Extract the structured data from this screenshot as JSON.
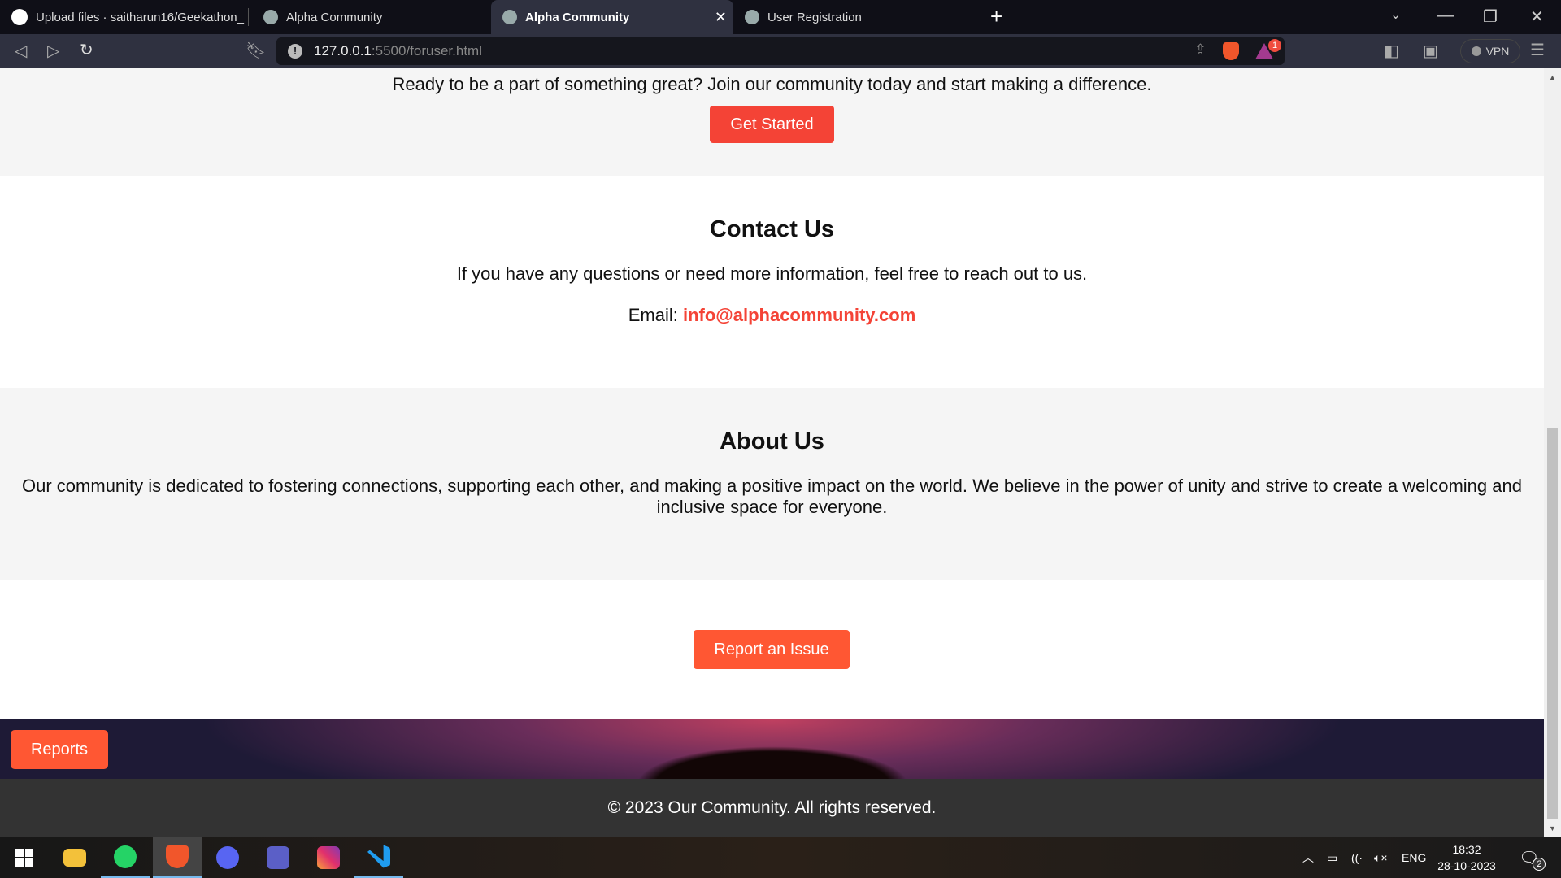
{
  "browser": {
    "tabs": [
      {
        "title": "Upload files · saitharun16/Geekathon_",
        "icon": "github-icon"
      },
      {
        "title": "Alpha Community",
        "icon": "globe-icon"
      },
      {
        "title": "Alpha Community",
        "icon": "globe-icon",
        "active": true
      },
      {
        "title": "User Registration",
        "icon": "globe-icon"
      }
    ],
    "url_host": "127.0.0.1",
    "url_rest": ":5500/foruser.html",
    "vpn_label": "VPN",
    "rewards_badge": "1"
  },
  "page": {
    "cta_text": "Ready to be a part of something great? Join our community today and start making a difference.",
    "get_started": "Get Started",
    "contact": {
      "title": "Contact Us",
      "text": "If you have any questions or need more information, feel free to reach out to us.",
      "email_label": "Email:",
      "email": "info@alphacommunity.com"
    },
    "about": {
      "title": "About Us",
      "text": "Our community is dedicated to fostering connections, supporting each other, and making a positive impact on the world. We believe in the power of unity and strive to create a welcoming and inclusive space for everyone."
    },
    "report_issue": "Report an Issue",
    "reports": "Reports",
    "footer": "© 2023 Our Community. All rights reserved.",
    "colors": {
      "get_started": "#f44336",
      "report": "#ff5733",
      "footer": "#333333"
    }
  },
  "taskbar": {
    "apps": [
      "windows-start",
      "file-explorer",
      "whatsapp",
      "brave",
      "discord",
      "teams",
      "instagram",
      "vscode"
    ],
    "language": "ENG",
    "time": "18:32",
    "date": "28-10-2023",
    "notifications": "2"
  }
}
